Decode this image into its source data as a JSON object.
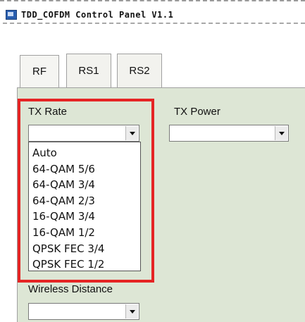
{
  "window": {
    "title": "TDD_COFDM Control Panel V1.1"
  },
  "tabs": [
    {
      "label": "RF"
    },
    {
      "label": "RS1"
    },
    {
      "label": "RS2"
    }
  ],
  "fields": {
    "tx_rate": {
      "label": "TX Rate",
      "value": ""
    },
    "tx_power": {
      "label": "TX Power",
      "value": ""
    },
    "wireless_distance": {
      "label": "Wireless Distance",
      "value": ""
    }
  },
  "tx_rate_options": [
    "Auto",
    "64-QAM 5/6",
    "64-QAM 3/4",
    "64-QAM 2/3",
    "16-QAM 3/4",
    "16-QAM 1/2",
    "QPSK FEC 3/4",
    "QPSK FEC 1/2"
  ],
  "colors": {
    "panel_bg": "#dde6d5",
    "highlight": "#e52424"
  }
}
